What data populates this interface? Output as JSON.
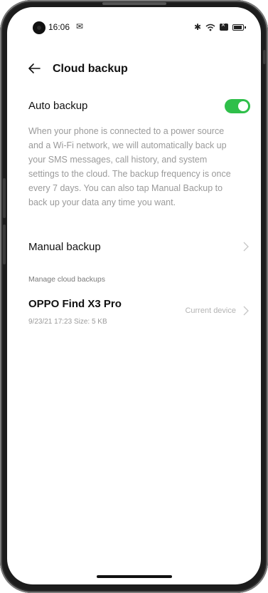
{
  "status_bar": {
    "time": "16:06",
    "mail_icon": "mail-icon",
    "bluetooth_icon": "bluetooth-icon",
    "wifi_icon": "wifi-icon",
    "sim_icon": "sim-icon",
    "battery_icon": "battery-icon"
  },
  "header": {
    "title": "Cloud backup",
    "back_icon": "arrow-left-icon"
  },
  "auto_backup": {
    "label": "Auto backup",
    "enabled": true,
    "toggle_color": "#2fbf4a",
    "description": "When your phone is connected to a power source and a Wi-Fi network, we will automatically back up your SMS messages, call history, and system settings to the cloud. The backup frequency is once every 7 days. You can also tap Manual Backup to back up your data any time you want."
  },
  "manual_backup": {
    "label": "Manual backup"
  },
  "manage_section": {
    "title": "Manage cloud backups",
    "device": {
      "name": "OPPO Find X3 Pro",
      "meta": "9/23/21 17:23  Size: 5 KB",
      "tag": "Current device"
    }
  }
}
